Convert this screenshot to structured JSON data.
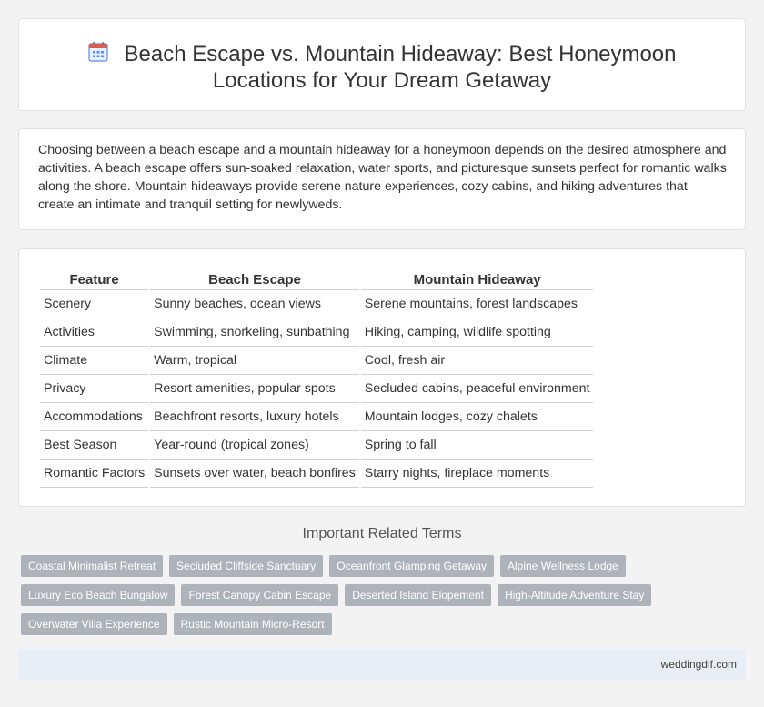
{
  "header": {
    "icon": "calendar-icon",
    "title_line1": "Beach Escape vs. Mountain Hideaway: Best Honeymoon",
    "title_line2": "Locations for Your Dream Getaway"
  },
  "intro": {
    "text": "Choosing between a beach escape and a mountain hideaway for a honeymoon depends on the desired atmosphere and activities. A beach escape offers sun-soaked relaxation, water sports, and picturesque sunsets perfect for romantic walks along the shore. Mountain hideaways provide serene nature experiences, cozy cabins, and hiking adventures that create an intimate and tranquil setting for newlyweds."
  },
  "table": {
    "headers": [
      "Feature",
      "Beach Escape",
      "Mountain Hideaway"
    ],
    "rows": [
      [
        "Scenery",
        "Sunny beaches, ocean views",
        "Serene mountains, forest landscapes"
      ],
      [
        "Activities",
        "Swimming, snorkeling, sunbathing",
        "Hiking, camping, wildlife spotting"
      ],
      [
        "Climate",
        "Warm, tropical",
        "Cool, fresh air"
      ],
      [
        "Privacy",
        "Resort amenities, popular spots",
        "Secluded cabins, peaceful environment"
      ],
      [
        "Accommodations",
        "Beachfront resorts, luxury hotels",
        "Mountain lodges, cozy chalets"
      ],
      [
        "Best Season",
        "Year-round (tropical zones)",
        "Spring to fall"
      ],
      [
        "Romantic Factors",
        "Sunsets over water, beach bonfires",
        "Starry nights, fireplace moments"
      ]
    ]
  },
  "related": {
    "title": "Important Related Terms",
    "rows": [
      [
        "Coastal Minimalist Retreat",
        "Secluded Cliffside Sanctuary",
        "Oceanfront Glamping Getaway",
        "Alpine Wellness Lodge"
      ],
      [
        "Luxury Eco Beach Bungalow",
        "Forest Canopy Cabin Escape",
        "Deserted Island Elopement",
        "High-Altitude Adventure Stay"
      ],
      [
        "Overwater Villa Experience",
        "Rustic Mountain Micro-Resort"
      ]
    ]
  },
  "footer": {
    "site": "weddingdif.com"
  },
  "colors": {
    "tag_bg": "#aeb3ba",
    "footer_bg": "#e8edf6",
    "icon_red": "#e05a4e",
    "icon_blue": "#5b8def"
  }
}
